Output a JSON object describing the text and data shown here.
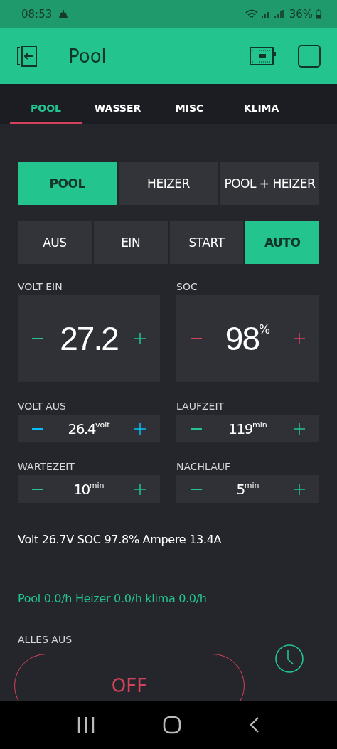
{
  "status_bar": {
    "time": "08:53",
    "battery": "36%"
  },
  "app_bar": {
    "title": "Pool"
  },
  "tabs": [
    {
      "label": "POOL",
      "selected": true
    },
    {
      "label": "WASSER",
      "selected": false
    },
    {
      "label": "MISC",
      "selected": false
    },
    {
      "label": "KLIMA",
      "selected": false
    }
  ],
  "mode_buttons": [
    {
      "label": "POOL",
      "selected": true
    },
    {
      "label": "HEIZER",
      "selected": false
    },
    {
      "label": "POOL + HEIZER",
      "selected": false
    }
  ],
  "state_buttons": [
    {
      "label": "AUS",
      "selected": false
    },
    {
      "label": "EIN",
      "selected": false
    },
    {
      "label": "START",
      "selected": false
    },
    {
      "label": "AUTO",
      "selected": true
    }
  ],
  "large_steppers": [
    {
      "label": "VOLT EIN",
      "value": "27.2",
      "color": "#23c48e"
    },
    {
      "label": "SOC",
      "value": "98",
      "unit": "%",
      "color": "#d3435c"
    }
  ],
  "small_steppers": [
    {
      "label": "VOLT AUS",
      "value": "26.4",
      "unit": "volt",
      "color": "#04c0f8"
    },
    {
      "label": "LAUFZEIT",
      "value": "119",
      "unit": "min",
      "color": "#23c48e"
    },
    {
      "label": "WARTEZEIT",
      "value": "10",
      "unit": "min",
      "color": "#23c48e"
    },
    {
      "label": "NACHLAUF",
      "value": "5",
      "unit": "min",
      "color": "#23c48e"
    }
  ],
  "readout": "Volt  26.7V  SOC 97.8%  Ampere 13.4A",
  "hours": "Pool 0.0/h Heizer 0.0/h klima  0.0/h",
  "off_section": {
    "label": "ALLES AUS",
    "button": "OFF"
  }
}
